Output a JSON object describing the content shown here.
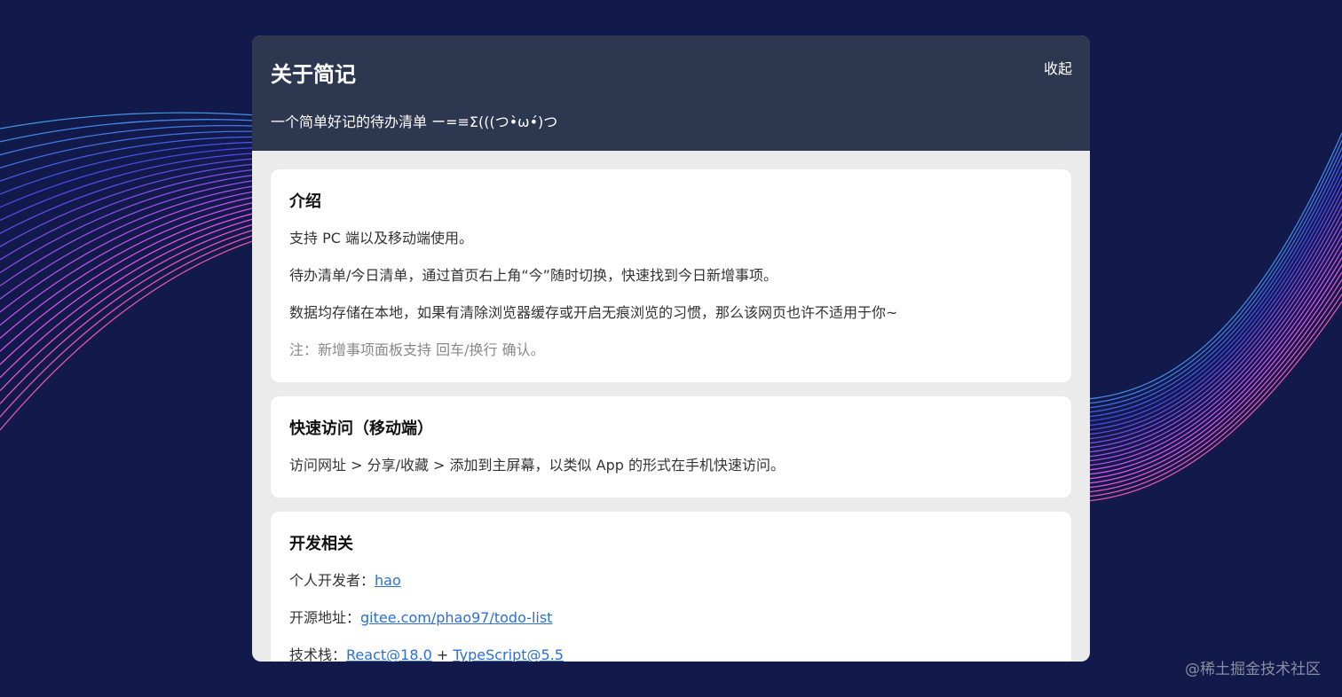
{
  "colors": {
    "background": "#111a4b",
    "header": "#2e3750",
    "body": "#ebebeb",
    "link": "#2b6fd6",
    "line_start": "#3d8fe8",
    "line_end": "#e0409a"
  },
  "header": {
    "title": "关于简记",
    "subtitle": "一个简单好记的待办清单 ー=≡Σ(((つ•̀ω•́)つ",
    "collapse_label": "收起"
  },
  "intro": {
    "heading": "介绍",
    "paragraphs": [
      "支持 PC 端以及移动端使用。",
      "待办清单/今日清单，通过首页右上角“今”随时切换，快速找到今日新增事项。",
      "数据均存储在本地，如果有清除浏览器缓存或开启无痕浏览的习惯，那么该网页也许不适用于你~"
    ],
    "note": "注：新增事项面板支持 回车/换行 确认。"
  },
  "quick": {
    "heading": "快速访问（移动端）",
    "text": "访问网址 > 分享/收藏 > 添加到主屏幕，以类似 App 的形式在手机快速访问。"
  },
  "dev": {
    "heading": "开发相关",
    "developer_label": "个人开发者：",
    "developer_link": "hao",
    "repo_label": "开源地址：",
    "repo_link": "gitee.com/phao97/todo-list",
    "stack_label": "技术栈：",
    "stack_link1": "React@18.0",
    "stack_plus": " + ",
    "stack_link2": "TypeScript@5.5"
  },
  "watermark": "@稀土掘金技术社区"
}
